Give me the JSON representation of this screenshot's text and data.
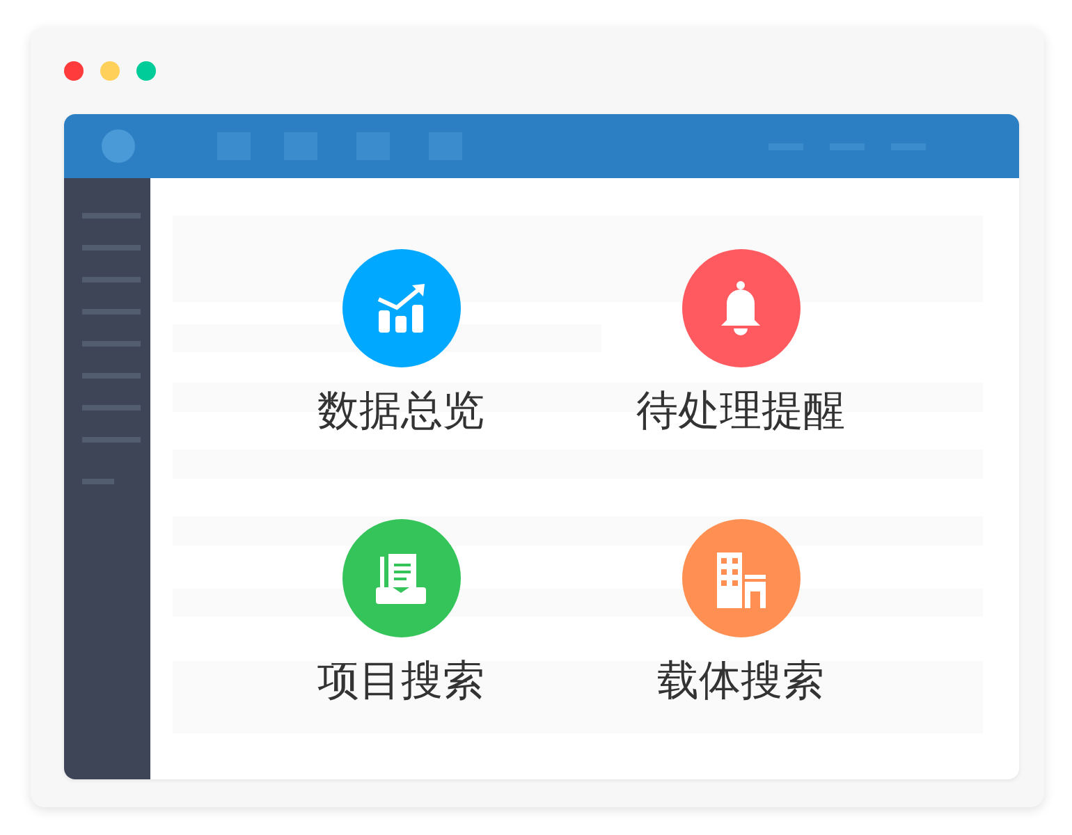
{
  "tiles": [
    {
      "label": "数据总览",
      "color": "#00a8ff"
    },
    {
      "label": "待处理提醒",
      "color": "#ff5a5f"
    },
    {
      "label": "项目搜索",
      "color": "#34c45a"
    },
    {
      "label": "载体搜索",
      "color": "#ff8f52"
    }
  ]
}
